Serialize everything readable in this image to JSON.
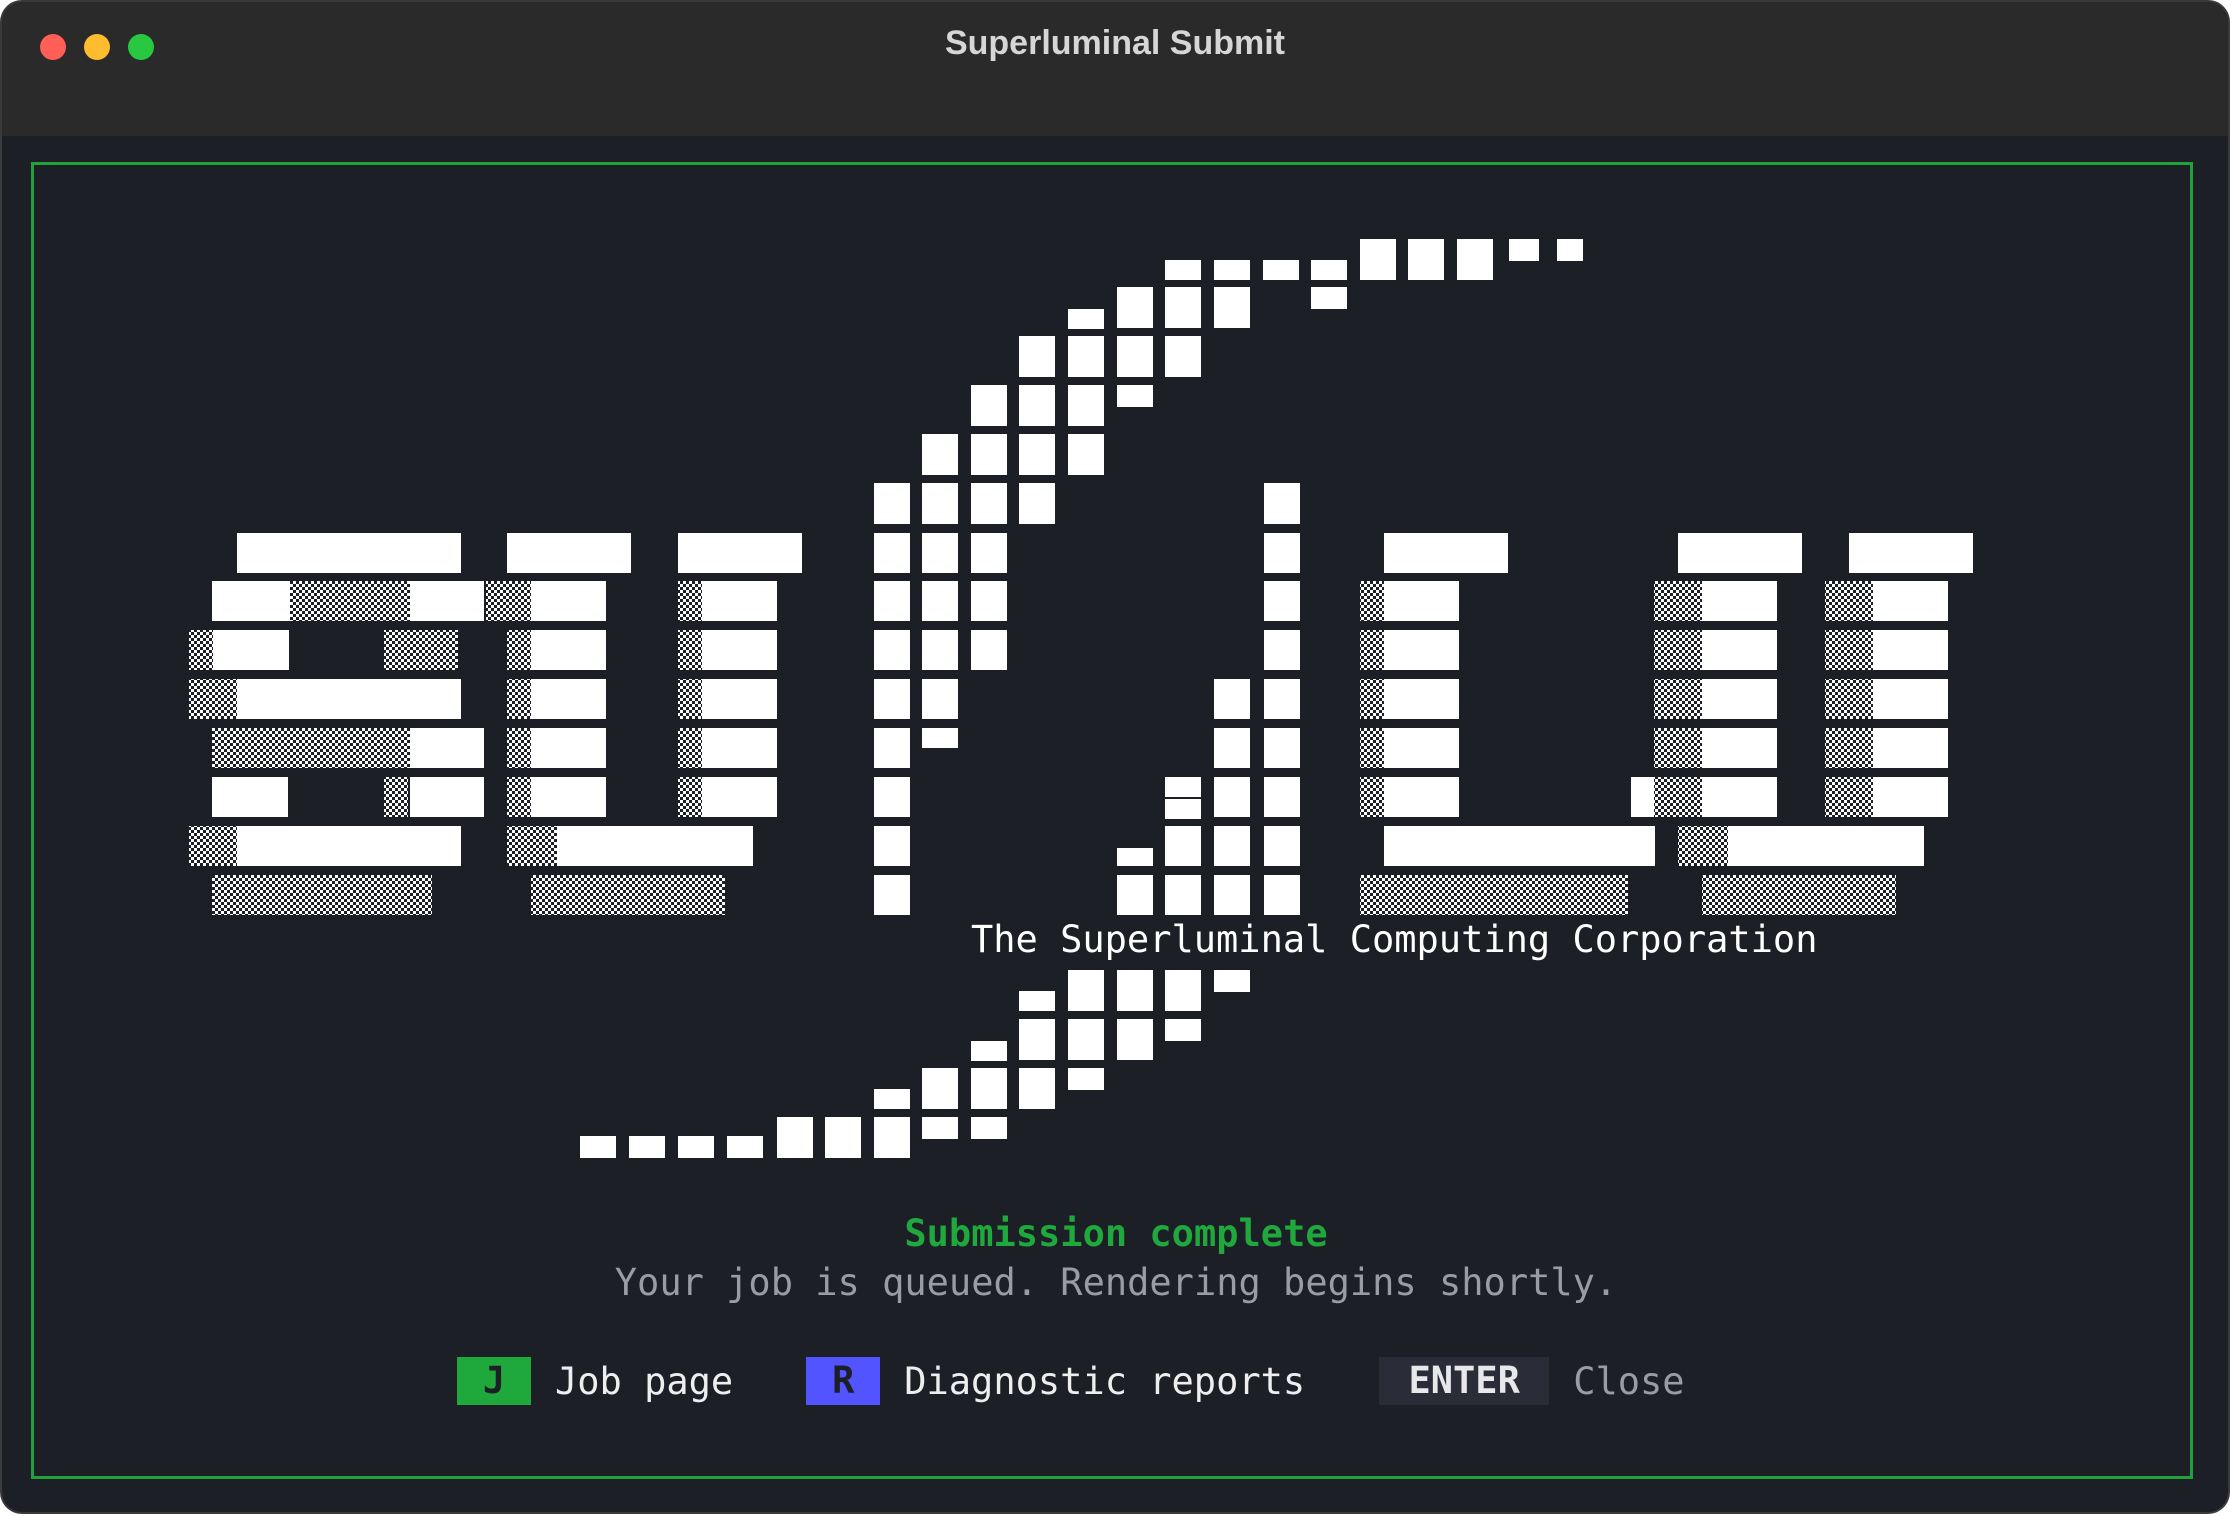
{
  "window": {
    "title": "Superluminal Submit"
  },
  "logo": {
    "tagline": "The Superluminal Computing Corporation"
  },
  "status": {
    "title": "Submission complete",
    "message": "Your job is queued. Rendering begins shortly."
  },
  "actions": [
    {
      "key": "J",
      "label": "Job page",
      "color": "#1fa83c"
    },
    {
      "key": "R",
      "label": "Diagnostic reports",
      "color": "#5254ff"
    },
    {
      "key": "ENTER",
      "label": "Close",
      "color": "#2a2d37"
    }
  ],
  "colors": {
    "border": "#22a03a",
    "background": "#1d1f27",
    "accent_green": "#1fa83c"
  }
}
